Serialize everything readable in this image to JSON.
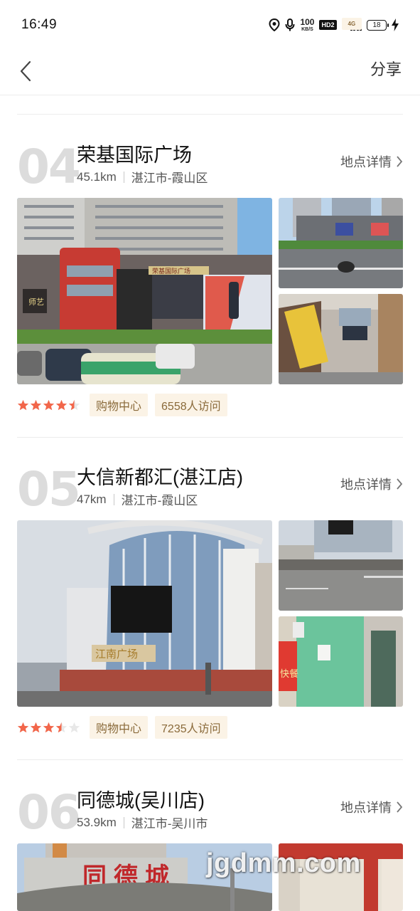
{
  "status_bar": {
    "time": "16:49",
    "speed_value": "100",
    "speed_unit": "KB/S",
    "hd_label": "HD2",
    "network": "4G",
    "battery": "18",
    "icons": [
      "location-icon",
      "microphone-icon",
      "signal-icon",
      "charging-icon"
    ]
  },
  "nav": {
    "back_icon": "back-arrow-icon",
    "share_label": "分享"
  },
  "places": [
    {
      "number": "04",
      "name": "荣基国际广场",
      "distance": "45.1km",
      "area": "湛江市-霞山区",
      "detail_label": "地点详情",
      "rating": 4.5,
      "category": "购物中心",
      "visits": "6558人访问",
      "photo_sign_main": "荣基国际广场",
      "photo_sign_logo": "师艺"
    },
    {
      "number": "05",
      "name": "大信新都汇(湛江店)",
      "distance": "47km",
      "area": "湛江市-霞山区",
      "detail_label": "地点详情",
      "rating": 3.5,
      "category": "购物中心",
      "visits": "7235人访问",
      "photo_sign_main": "江南广场",
      "photo_sign_side": "快餐"
    },
    {
      "number": "06",
      "name": "同德城(吴川店)",
      "distance": "53.9km",
      "area": "湛江市-吴川市",
      "detail_label": "地点详情",
      "photo_sign_main": "同德城"
    }
  ],
  "watermark": "jgdmm.com",
  "colors": {
    "accent_star": "#f2664a",
    "tag_bg": "#fbf3e6",
    "tag_text": "#8a6a3a",
    "number_gray": "#dcdcdc"
  }
}
